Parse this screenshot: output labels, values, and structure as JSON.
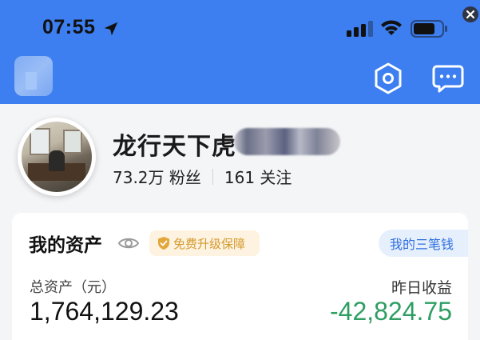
{
  "status_bar": {
    "time": "07:55"
  },
  "profile": {
    "username": "龙行天下虎",
    "followers": "73.2万 粉丝",
    "following": "161 关注"
  },
  "assets": {
    "title": "我的资产",
    "upgrade_badge": "免费升级保障",
    "three_money_button": "我的三笔钱",
    "total_label": "总资产（元）",
    "total_value": "1,764,129.23",
    "yesterday_label": "昨日收益",
    "yesterday_value": "-42,824.75"
  },
  "colors": {
    "header_blue": "#3d7ff0",
    "profit_negative": "#2e9e63",
    "badge_gold": "#d49a2e",
    "link_blue": "#2f6fe0"
  },
  "icons": [
    "location-arrow-icon",
    "signal-icon",
    "wifi-icon",
    "battery-icon",
    "close-icon",
    "settings-hexagon-icon",
    "message-icon",
    "eye-icon",
    "shield-icon"
  ]
}
